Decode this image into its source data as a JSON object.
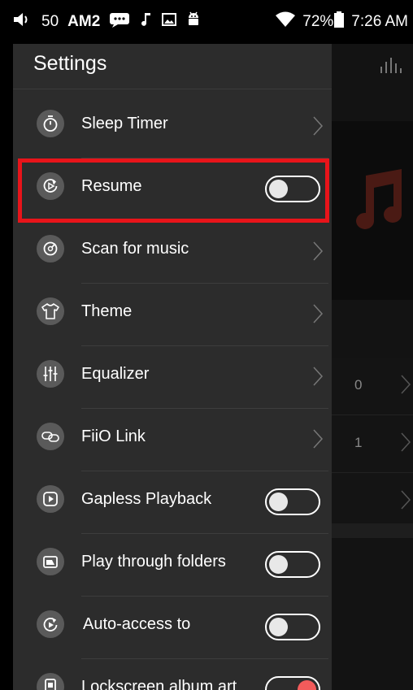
{
  "status_bar": {
    "volume_level": "50",
    "carrier": "AM2",
    "battery": "72%",
    "time": "7:26 AM"
  },
  "drawer": {
    "title": "Settings",
    "items": [
      {
        "label": "Sleep Timer",
        "control": "chevron",
        "icon": "timer-icon"
      },
      {
        "label": "Resume",
        "control": "toggle",
        "on": false,
        "icon": "resume-icon"
      },
      {
        "label": "Scan for music",
        "control": "chevron",
        "icon": "scan-icon"
      },
      {
        "label": "Theme",
        "control": "chevron",
        "icon": "theme-shirt-icon"
      },
      {
        "label": "Equalizer",
        "control": "chevron",
        "icon": "equalizer-icon"
      },
      {
        "label": "FiiO Link",
        "control": "chevron",
        "icon": "link-icon"
      },
      {
        "label": "Gapless Playback",
        "control": "toggle",
        "on": false,
        "icon": "gapless-icon"
      },
      {
        "label": "Play through folders",
        "control": "toggle",
        "on": false,
        "icon": "folder-play-icon"
      },
      {
        "label": "Auto-access to",
        "control": "toggle",
        "on": false,
        "icon": "auto-access-icon"
      },
      {
        "label": "Lockscreen album art",
        "control": "toggle",
        "on": true,
        "icon": "lockscreen-icon"
      }
    ]
  },
  "background": {
    "row_values": [
      "0",
      "1",
      ""
    ]
  },
  "colors": {
    "drawer_bg": "#2c2c2c",
    "highlight": "#e8141a",
    "toggle_on_knob": "#f25b5b",
    "icon_circle": "#5a5a5a"
  }
}
